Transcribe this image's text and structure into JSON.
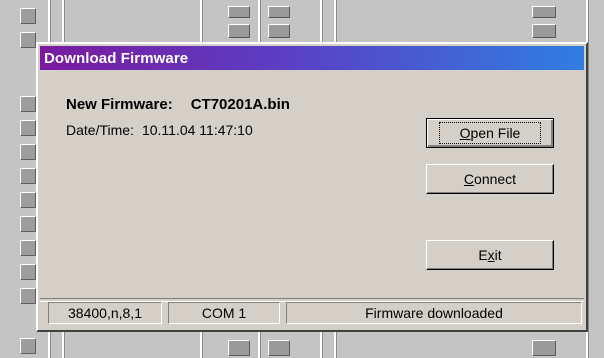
{
  "dialog": {
    "title": "Download Firmware",
    "firmware_label": "New Firmware:",
    "firmware_value": "CT70201A.bin",
    "datetime_label": "Date/Time:",
    "datetime_value": "10.11.04 11:47:10"
  },
  "buttons": {
    "open_file": {
      "accel": "O",
      "rest": "pen File"
    },
    "connect": {
      "accel": "C",
      "rest": "onnect"
    },
    "exit": {
      "pre": "E",
      "accel": "x",
      "post": "it"
    }
  },
  "statusbar": {
    "baud": "38400,n,8,1",
    "port": "COM 1",
    "message": "Firmware downloaded"
  },
  "colors": {
    "title_gradient_start": "#7a1aa0",
    "title_gradient_end": "#2f7ee2",
    "dialog_face": "#d4d0c8"
  }
}
